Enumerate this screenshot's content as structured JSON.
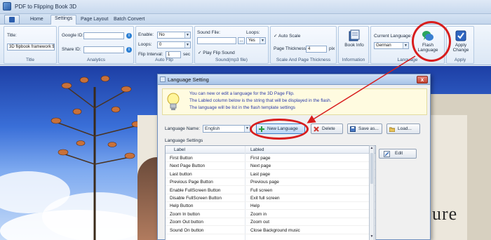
{
  "app": {
    "title": "PDF to Flipping Book 3D"
  },
  "tabs": [
    "Home",
    "Settings",
    "Page Layout",
    "Batch Convert"
  ],
  "ribbon": {
    "title": {
      "label": "Title:",
      "value": "3D flipbook framework $",
      "group": "Title"
    },
    "analytics": {
      "google_label": "Google ID:",
      "share_label": "Share ID:",
      "group": "Analytics"
    },
    "auto_flip": {
      "enable_label": "Enable:",
      "enable_value": "No",
      "loops_label": "Loops:",
      "loops_value": "0",
      "interval_label": "Flip Interval:",
      "interval_value": "1",
      "interval_unit": "sec",
      "group": "Auto Flip"
    },
    "sound": {
      "file_label": "Sound File:",
      "loops_label": "Loops:",
      "loops_value": "Yes",
      "browse": "...",
      "play_label": "Play Flip Sound",
      "group": "Sound(mp3 file)"
    },
    "scale": {
      "auto_label": "Auto Scale",
      "thickness_label": "Page Thickness:",
      "thickness_value": "4",
      "thickness_unit": "pix",
      "group": "Scale And Page Thickness"
    },
    "information": {
      "button": "Book Info",
      "group": "Information"
    },
    "language": {
      "current_label": "Current Language:",
      "current_value": "German",
      "button_line1": "Flash",
      "button_line2": "Language",
      "group": "Language"
    },
    "apply": {
      "line1": "Apply",
      "line2": "Change",
      "group": "Apply"
    }
  },
  "dialog": {
    "title": "Language Setting",
    "close": "x",
    "hint": [
      "You can new or edit  a language for the 3D Page Flip.",
      "The Labled column below is the string that will be displayed in the flash.",
      "The language will be list in the flash template settings"
    ],
    "language_name_label": "Language Name:",
    "language_name_value": "English",
    "buttons": {
      "new_language": "New Language",
      "delete": "Delete",
      "save_as": "Save as...",
      "load": "Load...",
      "edit": "Edit"
    },
    "settings_label": "Language Settings",
    "columns": [
      "Label",
      "Labled"
    ],
    "rows": [
      [
        "First Button",
        "First page"
      ],
      [
        "Next Page Button",
        "Next page"
      ],
      [
        "Last button",
        "Last page"
      ],
      [
        "Previous Page Button",
        "Previous page"
      ],
      [
        "Enable FullScreen Button",
        "Full screen"
      ],
      [
        "Disable FullScreen Button",
        "Exit full screen"
      ],
      [
        "Help Button",
        "Help"
      ],
      [
        "Zoom In button",
        "Zoom in"
      ],
      [
        "Zoom Out button",
        "Zoom out"
      ],
      [
        "Sound On button",
        "Close Background music"
      ]
    ]
  },
  "colors": {
    "highlight": "#d81d1d",
    "ribbon_bg": "#dbe7f5",
    "link_text": "#2b3ba8"
  }
}
